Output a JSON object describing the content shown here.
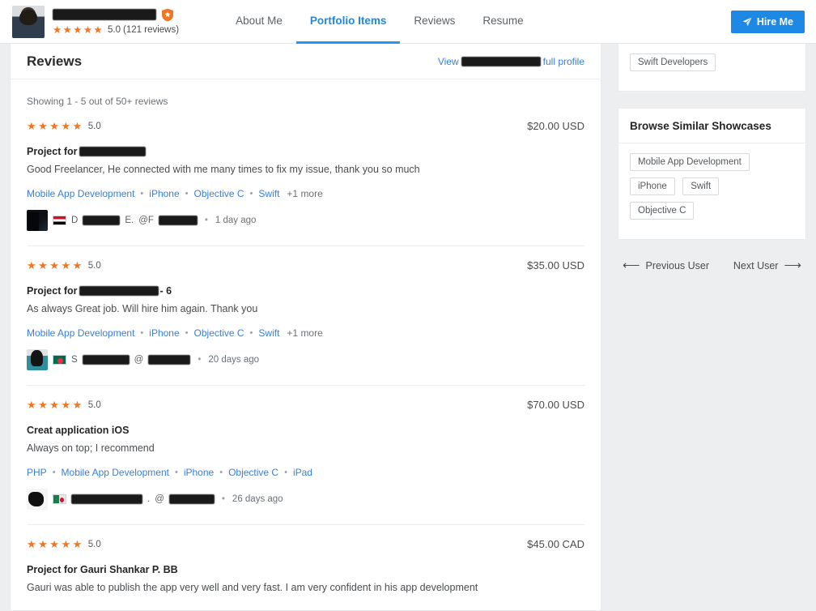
{
  "header": {
    "profile_name_redacted": true,
    "verified_badge_icon": "shield-check-icon",
    "stars": "★★★★★",
    "rating_value": "5.0",
    "rating_count": "(121 reviews)",
    "tabs": [
      {
        "label": "About Me",
        "active": false
      },
      {
        "label": "Portfolio Items",
        "active": true
      },
      {
        "label": "Reviews",
        "active": false
      },
      {
        "label": "Resume",
        "active": false
      }
    ],
    "hire_button": {
      "label": "Hire Me",
      "icon": "send-icon"
    }
  },
  "reviews_panel": {
    "title": "Reviews",
    "view_profile_prefix": "View",
    "view_profile_suffix": "full profile",
    "showing_text": "Showing 1 - 5 out of 50+ reviews",
    "items": [
      {
        "stars": "★★★★★",
        "score": "5.0",
        "price": "$20.00 USD",
        "project_prefix": "Project for",
        "project_suffix": "",
        "project_name_redacted": true,
        "project_redact_width": 82,
        "text": "Good Freelancer, He connected with me many times to fix my issue, thank you so much",
        "tags": [
          "Mobile App Development",
          "iPhone",
          "Objective C",
          "Swift"
        ],
        "more_label": "+1 more",
        "author_prefix": "D",
        "author_suffix": "E.",
        "author_name_redact_width": 46,
        "author_handle_prefix": "@F",
        "author_handle_redact_width": 48,
        "avatar_style": "av-dark",
        "flag_style": "flag-iraq",
        "flag_name": "iraq-flag",
        "time": "1 day ago"
      },
      {
        "stars": "★★★★★",
        "score": "5.0",
        "price": "$35.00 USD",
        "project_prefix": "Project for",
        "project_suffix": "- 6",
        "project_name_redacted": true,
        "project_redact_width": 98,
        "text": "As always Great job. Will hire him again. Thank you",
        "tags": [
          "Mobile App Development",
          "iPhone",
          "Objective C",
          "Swift"
        ],
        "more_label": "+1 more",
        "author_prefix": "S",
        "author_suffix": "",
        "author_name_redact_width": 58,
        "author_handle_prefix": "@",
        "author_handle_redact_width": 52,
        "avatar_style": "av-teal",
        "flag_style": "flag-bd",
        "flag_name": "bangladesh-flag",
        "time": "20 days ago"
      },
      {
        "stars": "★★★★★",
        "score": "5.0",
        "price": "$70.00 USD",
        "project_prefix": "Creat application iOS",
        "project_suffix": "",
        "project_name_redacted": false,
        "project_redact_width": 0,
        "text": "Always on top; I recommend",
        "tags": [
          "PHP",
          "Mobile App Development",
          "iPhone",
          "Objective C",
          "iPad"
        ],
        "more_label": "",
        "author_prefix": "",
        "author_suffix": ".",
        "author_name_redact_width": 88,
        "author_handle_prefix": "@",
        "author_handle_redact_width": 56,
        "avatar_style": "av-blob",
        "flag_style": "flag-alg",
        "flag_name": "algeria-flag",
        "time": "26 days ago"
      },
      {
        "stars": "★★★★★",
        "score": "5.0",
        "price": "$45.00 CAD",
        "project_prefix": "Project for Gauri Shankar P. BB",
        "project_suffix": "",
        "project_name_redacted": false,
        "project_redact_width": 0,
        "text": "Gauri was able to publish the app very well and very fast. I am very confident in his app development",
        "tags": [],
        "more_label": "",
        "author_prefix": "",
        "author_suffix": "",
        "author_name_redact_width": 0,
        "author_handle_prefix": "",
        "author_handle_redact_width": 0,
        "avatar_style": "av-dark",
        "flag_style": "flag-iraq",
        "flag_name": "flag",
        "time": ""
      }
    ]
  },
  "sidebar": {
    "top_card_chips": [
      "Swift Developers"
    ],
    "showcases_title": "Browse Similar Showcases",
    "showcase_chips_row1": [
      "Mobile App Development"
    ],
    "showcase_chips_row2": [
      "iPhone",
      "Swift",
      "Objective C"
    ],
    "previous_label": "Previous User",
    "next_label": "Next User",
    "prev_arrow": "⟵",
    "next_arrow": "⟶"
  },
  "colors": {
    "accent_blue": "#1e88e5",
    "link_blue": "#3a7fd5",
    "star_orange": "#f47521",
    "badge_orange": "#f47521",
    "page_bg": "#eceeef"
  }
}
